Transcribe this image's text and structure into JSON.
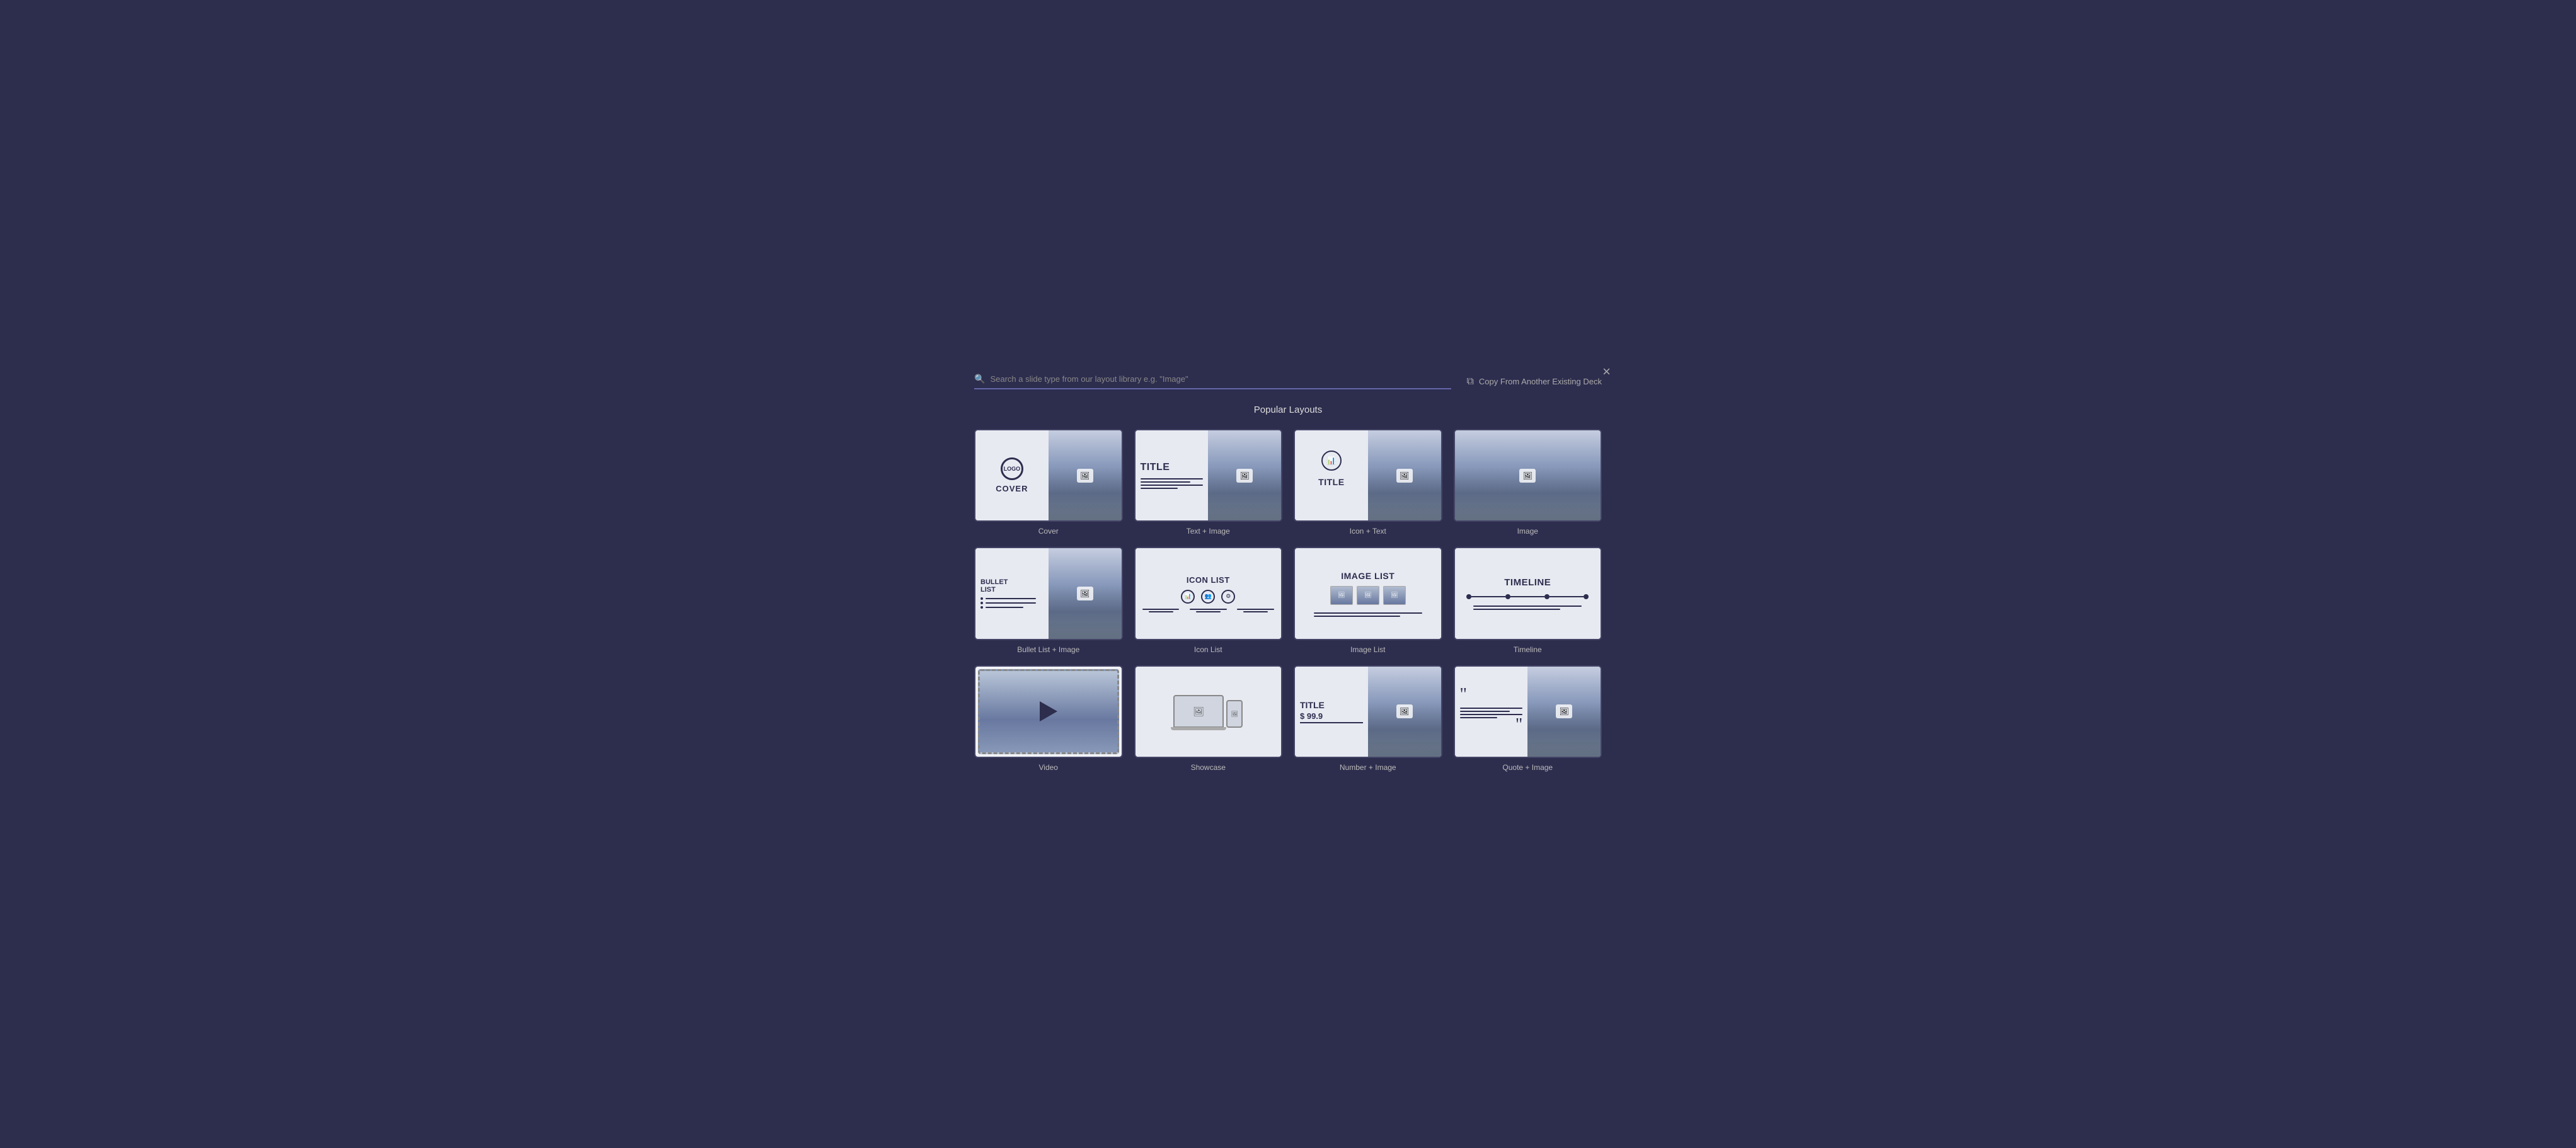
{
  "modal": {
    "title": "Popular Layouts",
    "close_label": "×",
    "search": {
      "placeholder": "Search a slide type from our layout library e.g. \"Image\""
    },
    "copy_deck_label": "Copy From Another Existing Deck"
  },
  "layouts": [
    {
      "id": "cover",
      "label": "Cover"
    },
    {
      "id": "text-image",
      "label": "Text + Image"
    },
    {
      "id": "icon-text",
      "label": "Icon + Text"
    },
    {
      "id": "image",
      "label": "Image"
    },
    {
      "id": "bullet-list",
      "label": "Bullet List + Image"
    },
    {
      "id": "icon-list",
      "label": "Icon List"
    },
    {
      "id": "image-list",
      "label": "Image List"
    },
    {
      "id": "timeline",
      "label": "Timeline"
    },
    {
      "id": "video",
      "label": "Video"
    },
    {
      "id": "showcase",
      "label": "Showcase"
    },
    {
      "id": "number-image",
      "label": "Number + Image"
    },
    {
      "id": "quote-image",
      "label": "Quote + Image"
    }
  ]
}
